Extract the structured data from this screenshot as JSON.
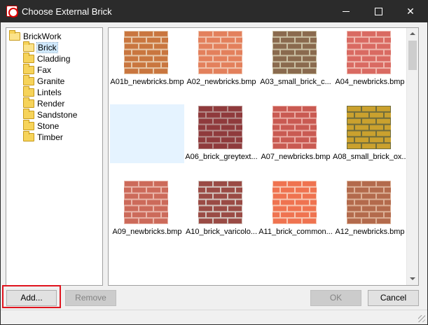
{
  "window": {
    "title": "Choose External Brick",
    "controls": {
      "minimize": "—",
      "maximize": "☐",
      "close": "✕"
    }
  },
  "tree": {
    "root": "BrickWork",
    "items": [
      {
        "label": "Brick",
        "selected": true
      },
      {
        "label": "Cladding"
      },
      {
        "label": "Fax"
      },
      {
        "label": "Granite"
      },
      {
        "label": "Lintels"
      },
      {
        "label": "Render"
      },
      {
        "label": "Sandstone"
      },
      {
        "label": "Stone"
      },
      {
        "label": "Timber"
      }
    ]
  },
  "tiles": [
    {
      "label": "A01b_newbricks.bmp",
      "brick": "#c9763f",
      "mortar": "#e6c7a8"
    },
    {
      "label": "A02_newbricks.bmp",
      "brick": "#e3805c",
      "mortar": "#f0c3ad"
    },
    {
      "label": "A03_small_brick_c...",
      "brick": "#8a6a4e",
      "mortar": "#c9bfa2"
    },
    {
      "label": "A04_newbricks.bmp",
      "brick": "#d96a62",
      "mortar": "#efb7ad"
    },
    {
      "label": "",
      "brick": "",
      "mortar": ""
    },
    {
      "label": "A06_brick_greytext...",
      "brick": "#8f3a3c",
      "mortar": "#b58c8a"
    },
    {
      "label": "A07_newbricks.bmp",
      "brick": "#c95a52",
      "mortar": "#e9a9a1"
    },
    {
      "label": "A08_small_brick_ox...",
      "brick": "#caa12e",
      "mortar": "#6f6c3c"
    },
    {
      "label": "A09_newbricks.bmp",
      "brick": "#cc6a5a",
      "mortar": "#e9b4a8"
    },
    {
      "label": "A10_brick_varicolo...",
      "brick": "#9a4b45",
      "mortar": "#d2c3bd"
    },
    {
      "label": "A11_brick_common...",
      "brick": "#ef7350",
      "mortar": "#f7c7b2"
    },
    {
      "label": "A12_newbricks.bmp",
      "brick": "#b36a4c",
      "mortar": "#dcb096"
    }
  ],
  "buttons": {
    "add": "Add...",
    "remove": "Remove",
    "ok": "OK",
    "cancel": "Cancel"
  }
}
